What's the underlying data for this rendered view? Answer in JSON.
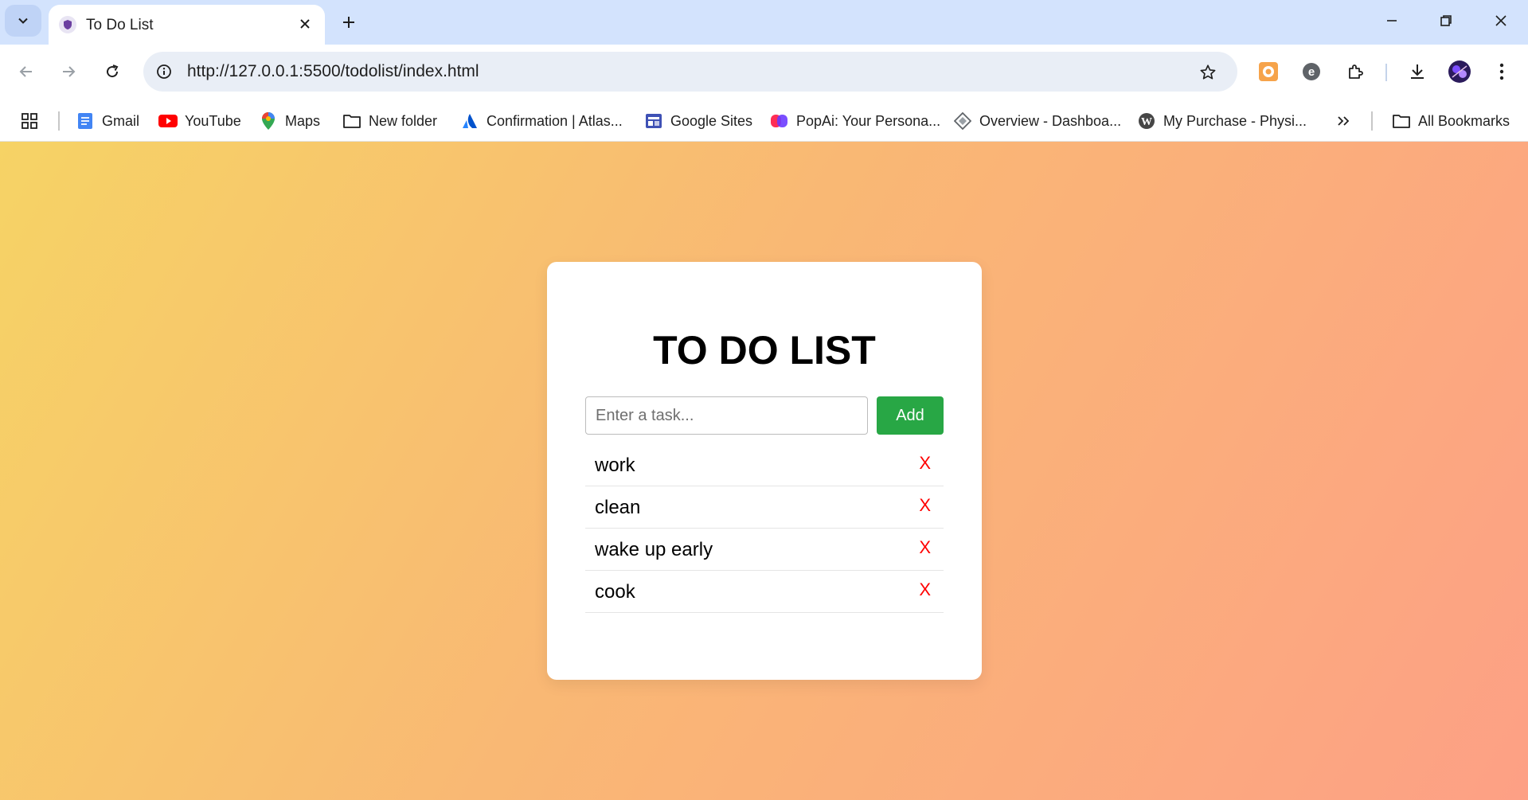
{
  "browser": {
    "tab": {
      "title": "To Do List"
    },
    "url": "http://127.0.0.1:5500/todolist/index.html",
    "bookmarks": [
      {
        "label": "Gmail",
        "icon": "gmail-icon"
      },
      {
        "label": "YouTube",
        "icon": "youtube-icon"
      },
      {
        "label": "Maps",
        "icon": "maps-icon"
      },
      {
        "label": "New folder",
        "icon": "folder-icon"
      },
      {
        "label": "Confirmation | Atlas...",
        "icon": "atlassian-icon"
      },
      {
        "label": "Google Sites",
        "icon": "google-sites-icon"
      },
      {
        "label": "PopAi: Your Persona...",
        "icon": "popai-icon"
      },
      {
        "label": "Overview - Dashboa...",
        "icon": "dashboard-icon"
      },
      {
        "label": "My Purchase - Physi...",
        "icon": "wordpress-icon"
      }
    ],
    "all_bookmarks_label": "All Bookmarks"
  },
  "app": {
    "title": "TO DO LIST",
    "input": {
      "placeholder": "Enter a task...",
      "value": ""
    },
    "add_label": "Add",
    "delete_label": "X",
    "tasks": [
      "work",
      "clean",
      "wake up early",
      "cook"
    ]
  },
  "colors": {
    "gradient_start": "#f6d365",
    "gradient_end": "#fda085",
    "add_button": "#28a745",
    "delete": "#ff0000"
  }
}
